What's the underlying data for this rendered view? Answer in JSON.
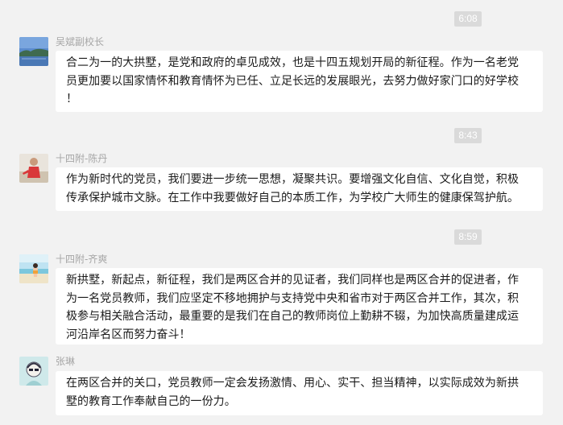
{
  "messages": [
    {
      "time": "6:08",
      "sender": "吴斌副校长",
      "avatar_icon": "landscape-photo-avatar",
      "lines": [
        "合二为一的大拱墅，是党和政府的卓见成效，也是十四五规划开局的新征程。作为一名老党",
        "员更加要以国家情怀和教育情怀为已任、立足长远的发展眼光，去努力做好家门口的好学校",
        "！"
      ]
    },
    {
      "time": "8:43",
      "sender": "十四附-陈丹",
      "avatar_icon": "person-photo-avatar",
      "lines": [
        "作为新时代的党员，我们要进一步统一思想，凝聚共识。要增强文化自信、文化自觉，积极",
        "传承保护城市文脉。在工作中我要做好自己的本质工作，为学校广大师生的健康保驾护航。"
      ]
    },
    {
      "time": "8:59",
      "sender": "十四附-齐爽",
      "avatar_icon": "beach-photo-avatar",
      "lines": [
        "新拱墅，新起点，新征程，我们是两区合并的见证者，我们同样也是两区合并的促进者，作",
        "为一名党员教师，我们应坚定不移地拥护与支持党中央和省市对于两区合并工作，其次，积",
        "极参与相关融合活动，最重要的是我们在自己的教师岗位上勤耕不辍，为加快高质量建成运",
        "河沿岸名区而努力奋斗！"
      ]
    },
    {
      "time": "",
      "sender": "张琳",
      "avatar_icon": "sketch-portrait-avatar",
      "lines": [
        "在两区合并的关口，党员教师一定会发扬激情、用心、实干、担当精神，以实际成效为新拱",
        "墅的教育工作奉献自己的一份力。"
      ]
    }
  ]
}
